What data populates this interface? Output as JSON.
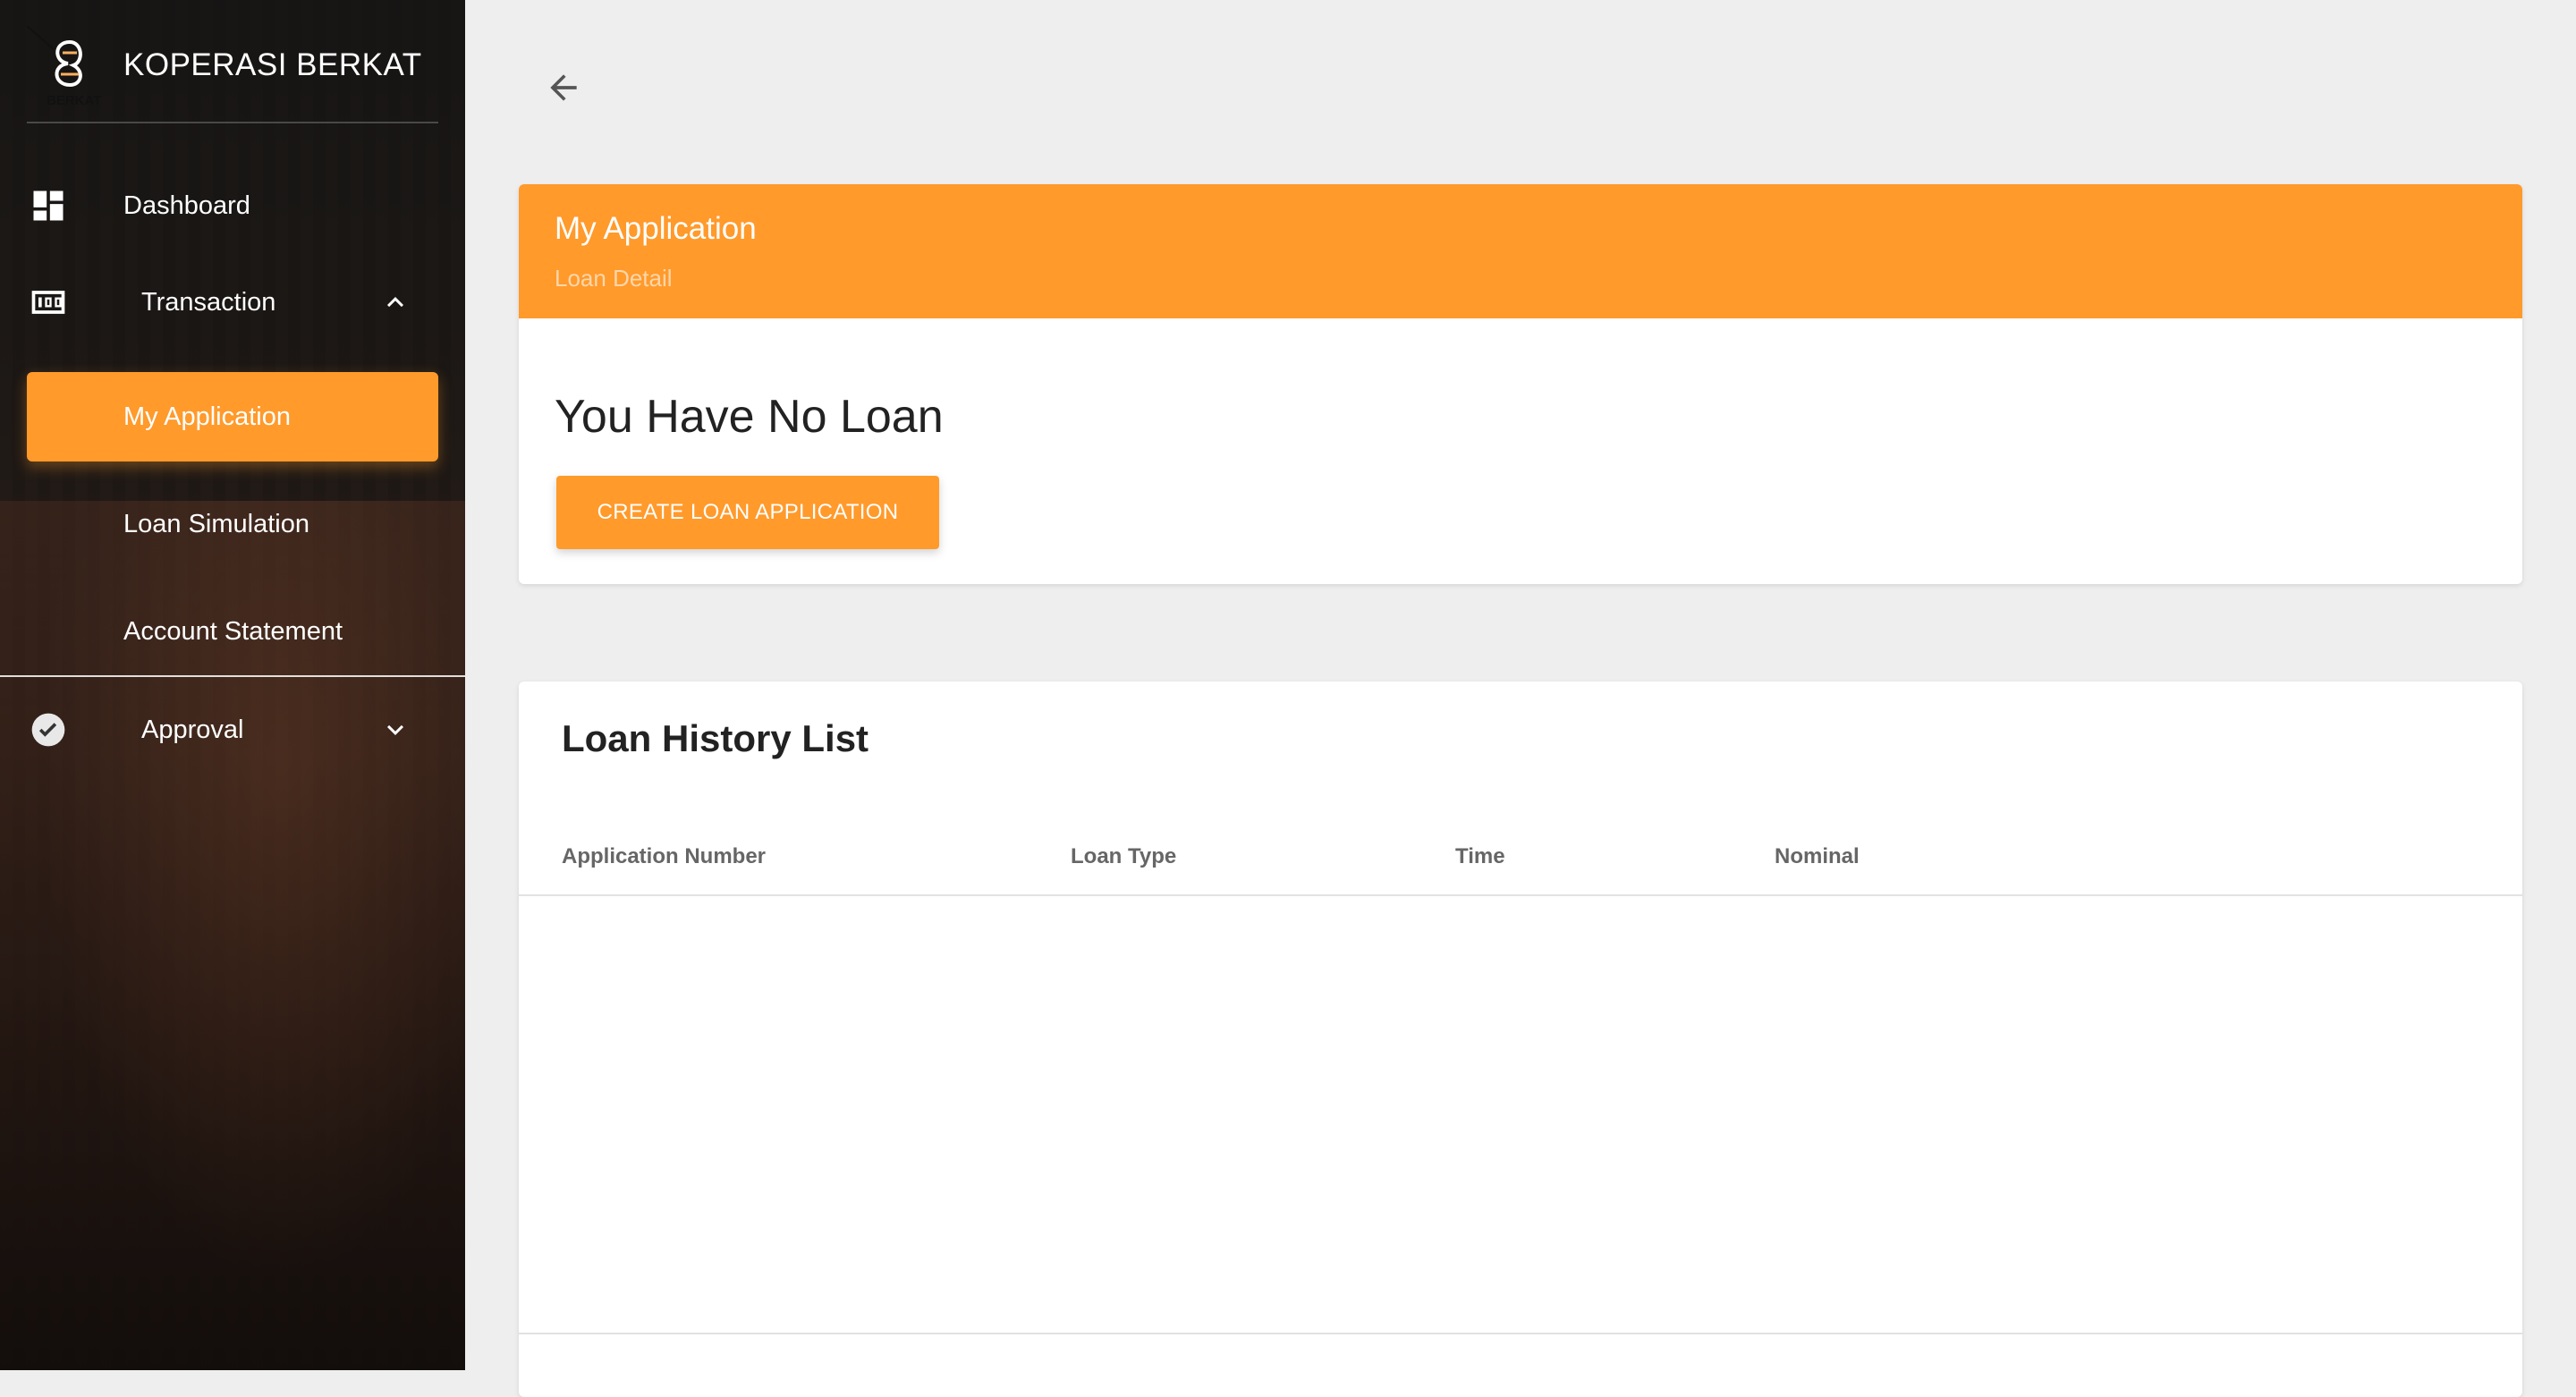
{
  "brand": {
    "name": "KOPERASI BERKAT",
    "logo_text": "BERKAT"
  },
  "sidebar": {
    "items": [
      {
        "label": "Dashboard",
        "icon": "dashboard-icon"
      },
      {
        "label": "Transaction",
        "icon": "transaction-icon",
        "expanded": true,
        "children": [
          {
            "label": "My Application",
            "active": true
          },
          {
            "label": "Loan Simulation"
          },
          {
            "label": "Account Statement"
          }
        ]
      },
      {
        "label": "Approval",
        "icon": "check-circle-icon",
        "expanded": false
      }
    ]
  },
  "header": {
    "back_icon": "arrow-left-icon"
  },
  "application_card": {
    "title": "My Application",
    "subtitle": "Loan Detail",
    "message": "You Have No Loan",
    "button_label": "CREATE LOAN APPLICATION"
  },
  "history": {
    "title": "Loan History List",
    "columns": [
      "Application Number",
      "Loan Type",
      "Time",
      "Nominal"
    ],
    "rows": []
  },
  "colors": {
    "accent": "#ff9a2b",
    "background": "#eeeeee",
    "card": "#ffffff"
  }
}
